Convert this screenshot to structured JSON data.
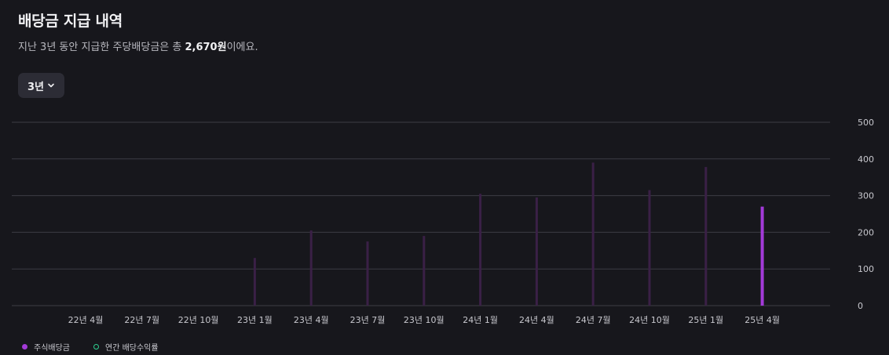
{
  "header": {
    "title": "배당금 지급 내역",
    "subtitle_prefix": "지난 3년 동안 지급한 주당배당금은 총 ",
    "subtitle_amount": "2,670원",
    "subtitle_suffix": "이에요."
  },
  "period_selector": {
    "label": "3년"
  },
  "colors": {
    "bar_faded": "#3a2046",
    "bar_active": "#a33ad8",
    "grid": "#3c3c44",
    "yield_marker": "#2ed191"
  },
  "chart_data": {
    "type": "bar",
    "categories": [
      "22년 4월",
      "22년 7월",
      "22년 10월",
      "23년 1월",
      "23년 4월",
      "23년 7월",
      "23년 10월",
      "24년 1월",
      "24년 4월",
      "24년 7월",
      "24년 10월",
      "25년 1월",
      "25년 4월"
    ],
    "series": [
      {
        "name": "주식배당금",
        "values": [
          0,
          0,
          0,
          130,
          205,
          175,
          190,
          305,
          295,
          390,
          315,
          378,
          270
        ]
      }
    ],
    "highlight_index": 12,
    "yticks": [
      0,
      100,
      200,
      300,
      400,
      500
    ],
    "ylim": [
      0,
      500
    ],
    "grid": true,
    "y_axis_position": "right",
    "legend_position": "bottom-left"
  },
  "legend": {
    "items": [
      {
        "label": "주식배당금",
        "icon": "filled-dot-icon"
      },
      {
        "label": "연간 배당수익률",
        "icon": "ring-dot-icon"
      }
    ]
  }
}
